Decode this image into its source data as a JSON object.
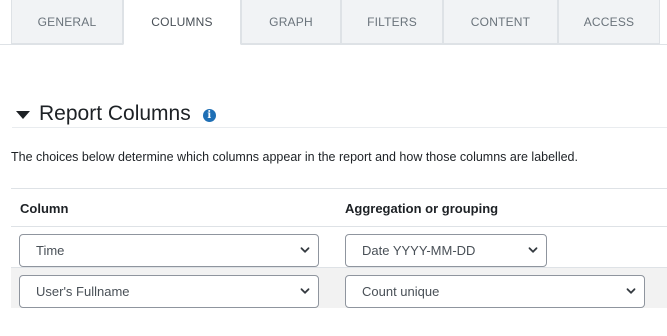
{
  "tabs": [
    {
      "label": "GENERAL",
      "active": false
    },
    {
      "label": "COLUMNS",
      "active": true
    },
    {
      "label": "GRAPH",
      "active": false
    },
    {
      "label": "FILTERS",
      "active": false
    },
    {
      "label": "CONTENT",
      "active": false
    },
    {
      "label": "ACCESS",
      "active": false
    }
  ],
  "section": {
    "title": "Report Columns",
    "info_icon": "info-circle-icon",
    "collapse_icon": "caret-down-icon",
    "description": "The choices below determine which columns appear in the report and how those columns are labelled."
  },
  "table": {
    "headers": {
      "column": "Column",
      "aggregation": "Aggregation or grouping"
    },
    "rows": [
      {
        "column": "Time",
        "aggregation": "Date YYYY-MM-DD"
      },
      {
        "column": "User's Fullname",
        "aggregation": "Count unique"
      }
    ]
  },
  "colors": {
    "info_icon": "#1f6fb5",
    "tab_inactive_bg": "#f1f3f5",
    "row_stripe": "#f2f2f2",
    "select_border": "#8f959e"
  }
}
